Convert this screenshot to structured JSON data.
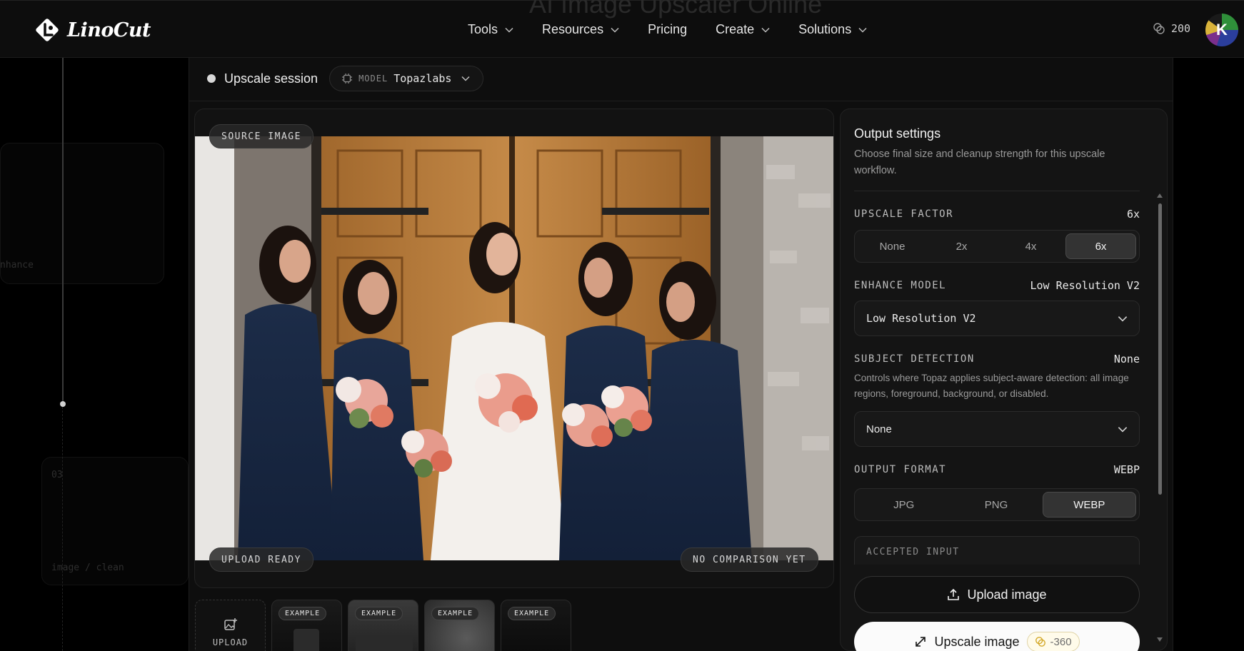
{
  "header": {
    "ghost_title": "AI Image Upscaler Online",
    "brand": "LinoCut",
    "nav": [
      "Tools",
      "Resources",
      "Pricing",
      "Create",
      "Solutions"
    ],
    "credits": "200",
    "avatar_initial": "K"
  },
  "left_panel": {
    "ghost_text_1": "nhance",
    "ghost_text_2": "03",
    "ghost_text_3": "image / clean"
  },
  "session": {
    "label": "Upscale session",
    "model_tag": "MODEL",
    "model_name": "Topazlabs"
  },
  "image_card": {
    "source_badge": "SOURCE IMAGE",
    "upload_ready": "UPLOAD READY",
    "no_comparison": "NO COMPARISON YET"
  },
  "thumbnails": {
    "upload_label": "UPLOAD",
    "example_label": "EXAMPLE"
  },
  "settings": {
    "title": "Output settings",
    "description": "Choose final size and cleanup strength for this upscale workflow.",
    "upscale_factor": {
      "label": "UPSCALE FACTOR",
      "value": "6x",
      "options": [
        "None",
        "2x",
        "4x",
        "6x"
      ],
      "selected": "6x"
    },
    "enhance_model": {
      "label": "ENHANCE MODEL",
      "value": "Low Resolution V2",
      "selected": "Low Resolution V2"
    },
    "subject_detection": {
      "label": "SUBJECT DETECTION",
      "value": "None",
      "help": "Controls where Topaz applies subject-aware detection: all image regions, foreground, background, or disabled.",
      "selected": "None"
    },
    "output_format": {
      "label": "OUTPUT FORMAT",
      "value": "WEBP",
      "options": [
        "JPG",
        "PNG",
        "WEBP"
      ],
      "selected": "WEBP"
    },
    "accepted_input_label": "ACCEPTED INPUT",
    "upload_button": "Upload image",
    "upscale_button": "Upscale image",
    "upscale_cost": "-360"
  }
}
